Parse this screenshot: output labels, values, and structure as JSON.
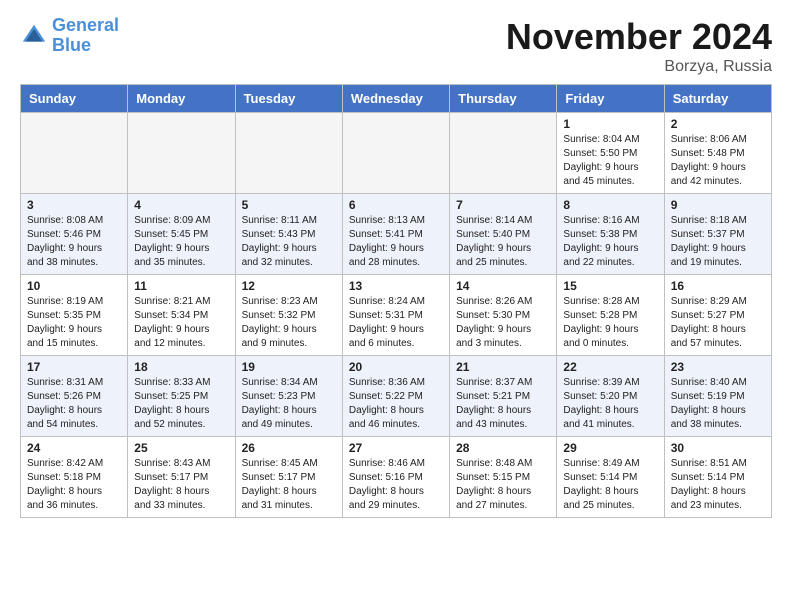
{
  "header": {
    "logo_line1": "General",
    "logo_line2": "Blue",
    "month": "November 2024",
    "location": "Borzya, Russia"
  },
  "days_of_week": [
    "Sunday",
    "Monday",
    "Tuesday",
    "Wednesday",
    "Thursday",
    "Friday",
    "Saturday"
  ],
  "weeks": [
    [
      {
        "day": "",
        "info": ""
      },
      {
        "day": "",
        "info": ""
      },
      {
        "day": "",
        "info": ""
      },
      {
        "day": "",
        "info": ""
      },
      {
        "day": "",
        "info": ""
      },
      {
        "day": "1",
        "info": "Sunrise: 8:04 AM\nSunset: 5:50 PM\nDaylight: 9 hours and 45 minutes."
      },
      {
        "day": "2",
        "info": "Sunrise: 8:06 AM\nSunset: 5:48 PM\nDaylight: 9 hours and 42 minutes."
      }
    ],
    [
      {
        "day": "3",
        "info": "Sunrise: 8:08 AM\nSunset: 5:46 PM\nDaylight: 9 hours and 38 minutes."
      },
      {
        "day": "4",
        "info": "Sunrise: 8:09 AM\nSunset: 5:45 PM\nDaylight: 9 hours and 35 minutes."
      },
      {
        "day": "5",
        "info": "Sunrise: 8:11 AM\nSunset: 5:43 PM\nDaylight: 9 hours and 32 minutes."
      },
      {
        "day": "6",
        "info": "Sunrise: 8:13 AM\nSunset: 5:41 PM\nDaylight: 9 hours and 28 minutes."
      },
      {
        "day": "7",
        "info": "Sunrise: 8:14 AM\nSunset: 5:40 PM\nDaylight: 9 hours and 25 minutes."
      },
      {
        "day": "8",
        "info": "Sunrise: 8:16 AM\nSunset: 5:38 PM\nDaylight: 9 hours and 22 minutes."
      },
      {
        "day": "9",
        "info": "Sunrise: 8:18 AM\nSunset: 5:37 PM\nDaylight: 9 hours and 19 minutes."
      }
    ],
    [
      {
        "day": "10",
        "info": "Sunrise: 8:19 AM\nSunset: 5:35 PM\nDaylight: 9 hours and 15 minutes."
      },
      {
        "day": "11",
        "info": "Sunrise: 8:21 AM\nSunset: 5:34 PM\nDaylight: 9 hours and 12 minutes."
      },
      {
        "day": "12",
        "info": "Sunrise: 8:23 AM\nSunset: 5:32 PM\nDaylight: 9 hours and 9 minutes."
      },
      {
        "day": "13",
        "info": "Sunrise: 8:24 AM\nSunset: 5:31 PM\nDaylight: 9 hours and 6 minutes."
      },
      {
        "day": "14",
        "info": "Sunrise: 8:26 AM\nSunset: 5:30 PM\nDaylight: 9 hours and 3 minutes."
      },
      {
        "day": "15",
        "info": "Sunrise: 8:28 AM\nSunset: 5:28 PM\nDaylight: 9 hours and 0 minutes."
      },
      {
        "day": "16",
        "info": "Sunrise: 8:29 AM\nSunset: 5:27 PM\nDaylight: 8 hours and 57 minutes."
      }
    ],
    [
      {
        "day": "17",
        "info": "Sunrise: 8:31 AM\nSunset: 5:26 PM\nDaylight: 8 hours and 54 minutes."
      },
      {
        "day": "18",
        "info": "Sunrise: 8:33 AM\nSunset: 5:25 PM\nDaylight: 8 hours and 52 minutes."
      },
      {
        "day": "19",
        "info": "Sunrise: 8:34 AM\nSunset: 5:23 PM\nDaylight: 8 hours and 49 minutes."
      },
      {
        "day": "20",
        "info": "Sunrise: 8:36 AM\nSunset: 5:22 PM\nDaylight: 8 hours and 46 minutes."
      },
      {
        "day": "21",
        "info": "Sunrise: 8:37 AM\nSunset: 5:21 PM\nDaylight: 8 hours and 43 minutes."
      },
      {
        "day": "22",
        "info": "Sunrise: 8:39 AM\nSunset: 5:20 PM\nDaylight: 8 hours and 41 minutes."
      },
      {
        "day": "23",
        "info": "Sunrise: 8:40 AM\nSunset: 5:19 PM\nDaylight: 8 hours and 38 minutes."
      }
    ],
    [
      {
        "day": "24",
        "info": "Sunrise: 8:42 AM\nSunset: 5:18 PM\nDaylight: 8 hours and 36 minutes."
      },
      {
        "day": "25",
        "info": "Sunrise: 8:43 AM\nSunset: 5:17 PM\nDaylight: 8 hours and 33 minutes."
      },
      {
        "day": "26",
        "info": "Sunrise: 8:45 AM\nSunset: 5:17 PM\nDaylight: 8 hours and 31 minutes."
      },
      {
        "day": "27",
        "info": "Sunrise: 8:46 AM\nSunset: 5:16 PM\nDaylight: 8 hours and 29 minutes."
      },
      {
        "day": "28",
        "info": "Sunrise: 8:48 AM\nSunset: 5:15 PM\nDaylight: 8 hours and 27 minutes."
      },
      {
        "day": "29",
        "info": "Sunrise: 8:49 AM\nSunset: 5:14 PM\nDaylight: 8 hours and 25 minutes."
      },
      {
        "day": "30",
        "info": "Sunrise: 8:51 AM\nSunset: 5:14 PM\nDaylight: 8 hours and 23 minutes."
      }
    ]
  ]
}
